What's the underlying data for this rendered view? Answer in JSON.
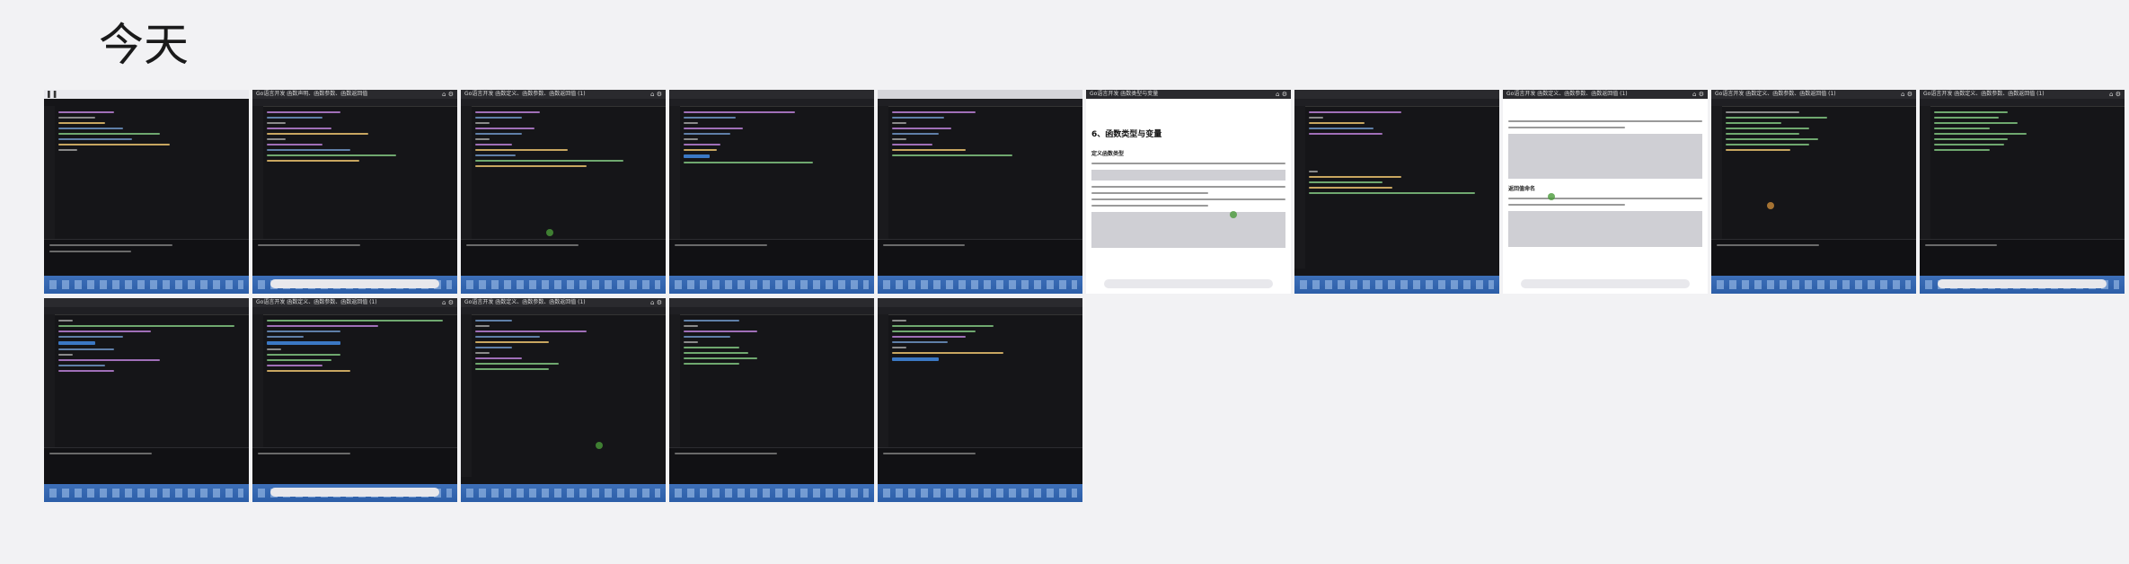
{
  "heading": "今天",
  "thumbnails": [
    {
      "title": "",
      "style": "dark"
    },
    {
      "title": "Go语言开发 函数声明、函数参数、函数返回值",
      "style": "dark"
    },
    {
      "title": "Go语言开发 函数定义、函数参数、函数返回值 (1)",
      "style": "dark"
    },
    {
      "title": "",
      "style": "dark"
    },
    {
      "title": "",
      "style": "dark"
    },
    {
      "title": "Go语言开发 函数类型与变量",
      "style": "light",
      "doc_heading": "6、函数类型与变量",
      "doc_sub": "定义函数类型"
    },
    {
      "title": "",
      "style": "dark"
    },
    {
      "title": "Go语言开发 函数定义、函数参数、函数返回值 (1)",
      "style": "light",
      "doc_heading": "",
      "doc_sub": "返回值命名"
    },
    {
      "title": "Go语言开发 函数定义、函数参数、函数返回值 (1)",
      "style": "dark"
    },
    {
      "title": "Go语言开发 函数定义、函数参数、函数返回值 (1)",
      "style": "dark"
    },
    {
      "title": "",
      "style": "dark"
    },
    {
      "title": "Go语言开发 函数定义、函数参数、函数返回值 (1)",
      "style": "dark"
    },
    {
      "title": "Go语言开发 函数定义、函数参数、函数返回值 (1)",
      "style": "dark"
    },
    {
      "title": "",
      "style": "dark"
    },
    {
      "title": "",
      "style": "dark"
    }
  ]
}
